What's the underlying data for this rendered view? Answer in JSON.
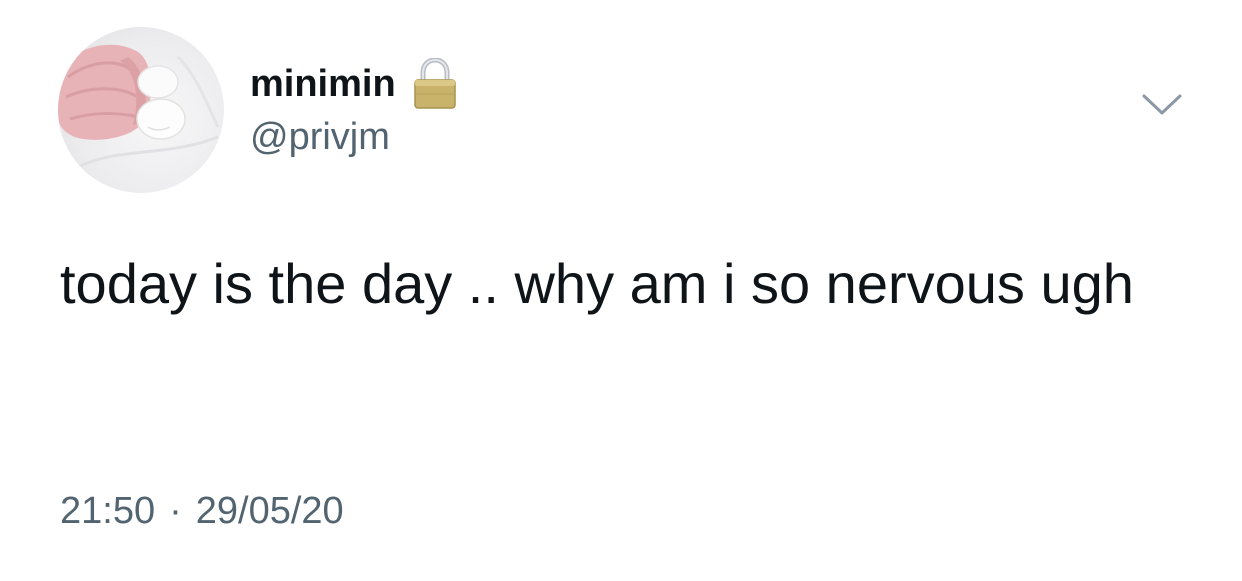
{
  "user": {
    "display_name": "minimin",
    "handle": "@privjm",
    "protected_icon": "lock-icon",
    "avatar_icon": "cat-paw-avatar"
  },
  "tweet": {
    "text": "today is the day .. why am i so nervous ugh",
    "time": "21:50",
    "separator": "·",
    "date": "29/05/20"
  },
  "actions": {
    "menu_icon": "chevron-down-icon"
  },
  "colors": {
    "text": "#0f1419",
    "secondary": "#536471",
    "lock_gold": "#c9b26a"
  }
}
